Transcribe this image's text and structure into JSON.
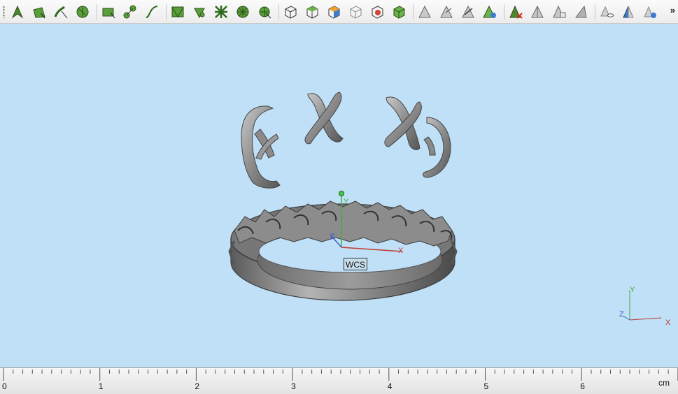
{
  "toolbar": {
    "tools": [
      {
        "name": "select-icon",
        "group": 1
      },
      {
        "name": "select-face-icon",
        "group": 1
      },
      {
        "name": "select-curve-icon",
        "group": 1
      },
      {
        "name": "select-solid-icon",
        "group": 1
      },
      {
        "name": "rectangle-icon",
        "group": 2
      },
      {
        "name": "node-edit-icon",
        "group": 2
      },
      {
        "name": "curve-icon",
        "group": 2
      },
      {
        "name": "grid-select-icon",
        "group": 3
      },
      {
        "name": "fan-icon",
        "group": 3
      },
      {
        "name": "cross-pattern-icon",
        "group": 3
      },
      {
        "name": "circle-divide-icon",
        "group": 3
      },
      {
        "name": "wheel-icon",
        "group": 3
      },
      {
        "name": "cube-front-icon",
        "group": 4
      },
      {
        "name": "cube-top-icon",
        "group": 4
      },
      {
        "name": "cube-side-icon",
        "group": 4
      },
      {
        "name": "cube-wire-icon",
        "group": 4
      },
      {
        "name": "cube-target-icon",
        "group": 4
      },
      {
        "name": "cube-green-icon",
        "group": 4
      },
      {
        "name": "pyramid-select-icon",
        "group": 5
      },
      {
        "name": "pyramid-edit-icon",
        "group": 5
      },
      {
        "name": "pyramid-arrow-icon",
        "group": 5
      },
      {
        "name": "pyramid-globe-icon",
        "group": 5
      },
      {
        "name": "delete-icon",
        "group": 6
      },
      {
        "name": "pyramid-split-icon",
        "group": 6
      },
      {
        "name": "pyramid-copy-icon",
        "group": 6
      },
      {
        "name": "pyramid-shade-icon",
        "group": 6
      },
      {
        "name": "eye-hide-icon",
        "group": 7
      },
      {
        "name": "eye-layers-icon",
        "group": 7
      },
      {
        "name": "eye-show-icon",
        "group": 7
      }
    ],
    "more_label": "»"
  },
  "viewport": {
    "wcs_label": "WCS",
    "triad": {
      "x": "X",
      "y": "Y",
      "z": "Z"
    },
    "wcs_axes": {
      "x": "X",
      "y": "Y",
      "z": "Z"
    }
  },
  "ruler": {
    "unit": "cm",
    "ticks": [
      "0",
      "1",
      "2",
      "3",
      "4",
      "5",
      "6"
    ]
  }
}
